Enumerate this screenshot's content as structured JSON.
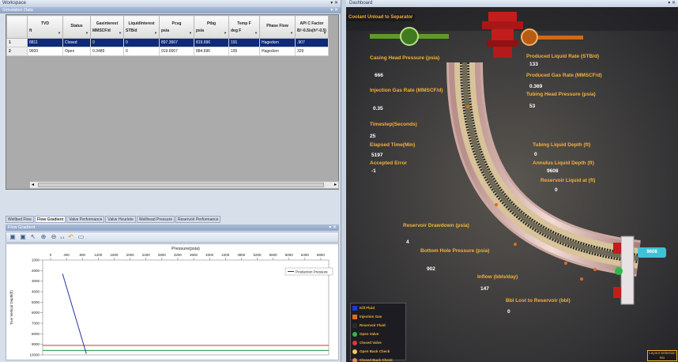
{
  "workspace": {
    "title": "Workspace",
    "sim_panel_title": "Simulation Data",
    "grid": {
      "columns": [
        {
          "name": "TVD",
          "unit": "ft"
        },
        {
          "name": "Status",
          "unit": ""
        },
        {
          "name": "Gasinterest",
          "unit": "MMSCF/d"
        },
        {
          "name": "LiquidInterest",
          "unit": "STB/d"
        },
        {
          "name": "Pcsg",
          "unit": "psia"
        },
        {
          "name": "Ptbg",
          "unit": "psia"
        },
        {
          "name": "Temp F",
          "unit": "deg F"
        },
        {
          "name": "Phase Flow",
          "unit": ""
        },
        {
          "name": "API C Factor",
          "unit": "B/~0.5/s(h^-0.5)"
        }
      ],
      "rows": [
        {
          "index": "1",
          "cells": [
            "8811",
            "Closed",
            "0",
            "0",
            "897.3667",
            "819.696",
            "191",
            "Hagedorn",
            ".907"
          ]
        },
        {
          "index": "2",
          "cells": [
            "9600",
            "Open",
            "0.3489",
            "0",
            "919.0067",
            "884.696",
            "195",
            "Hagedorn",
            "329"
          ]
        }
      ]
    },
    "tabs": [
      "Wellbed Flow",
      "Flow Gradient",
      "Valve Performance",
      "Valve Hourlete",
      "Wellhead Pressure",
      "Reservoir Performance"
    ],
    "active_tab": 1
  },
  "flow_gradient": {
    "title": "Flow Gradient",
    "toolbar_zoom": "1:1"
  },
  "chart_data": {
    "type": "line",
    "xlabel": "Pressure(psia)",
    "ylabel": "True Vertical Depth(ft)",
    "x_ticks": [
      0,
      400,
      800,
      1200,
      1600,
      2000,
      2400,
      2800,
      3200,
      3600,
      4000,
      4400,
      4800,
      5200,
      5600,
      6000,
      6400,
      6800
    ],
    "y_ticks": [
      1000,
      2000,
      3000,
      4000,
      5000,
      6000,
      7000,
      8000,
      9000,
      10000
    ],
    "xlim": [
      -200,
      7000
    ],
    "ylim": [
      1000,
      10000
    ],
    "series": [
      {
        "name": "Production Pressure",
        "color": "#2432a8",
        "x": [
          300,
          900
        ],
        "y": [
          2300,
          9900
        ]
      }
    ],
    "reference_lines": [
      {
        "y": 9100,
        "color": "#d33a2c"
      },
      {
        "y": 9580,
        "color": "#1a9a3a"
      }
    ]
  },
  "dashboard": {
    "title": "Dashboard",
    "banner": "Coolant Unload to Separator",
    "metrics": [
      {
        "label": "Casing Head Pressure (psia)",
        "value": "666"
      },
      {
        "label": "Injection Gas Rate (MMSCF/d)",
        "value": "0.35"
      },
      {
        "label": "Timestep(Seconds)",
        "value": "25"
      },
      {
        "label": "Elapsed Time(Min)",
        "value": "5197"
      },
      {
        "label": "Accepted Error",
        "value": "-1"
      },
      {
        "label": "Produced Liquid Rate (STB/d)",
        "value": "133"
      },
      {
        "label": "Produced Gas Rate (MMSCF/d)",
        "value": "0.369"
      },
      {
        "label": "Tubing Head Pressure (psia)",
        "value": "53"
      },
      {
        "label": "Tubing Liquid Depth (ft)",
        "value": "0"
      },
      {
        "label": "Annulus Liquid Depth (ft)",
        "value": "9608"
      },
      {
        "label": "Reservoir Liquid at (ft)",
        "value": "0"
      },
      {
        "label": "Reservoir Drawdown (psia)",
        "value": "4"
      },
      {
        "label": "Bottom Hole Pressure (psia)",
        "value": "902"
      },
      {
        "label": "Inflow (bbls/day)",
        "value": "147"
      },
      {
        "label": "Bbl Lost to Reservoir (bbl)",
        "value": "0"
      }
    ],
    "depth_tag": "9608",
    "legend": [
      {
        "label": "Kill Fluid",
        "color": "#1b3bd1",
        "shape": "square"
      },
      {
        "label": "Injection Gas",
        "color": "#e06a1e",
        "shape": "square"
      },
      {
        "label": "Reservoir Fluid",
        "color": "#2a2a2a",
        "shape": "square"
      },
      {
        "label": "Open Valve",
        "color": "#2fb84a",
        "shape": "circle"
      },
      {
        "label": "Closed Valve",
        "color": "#e03a3a",
        "shape": "circle"
      },
      {
        "label": "Open Back Check",
        "color": "#f0c860",
        "shape": "circle"
      },
      {
        "label": "Closed Back Check",
        "color": "#f08a4a",
        "shape": "circle"
      }
    ],
    "layer_button": "Layout Selection Mo"
  }
}
